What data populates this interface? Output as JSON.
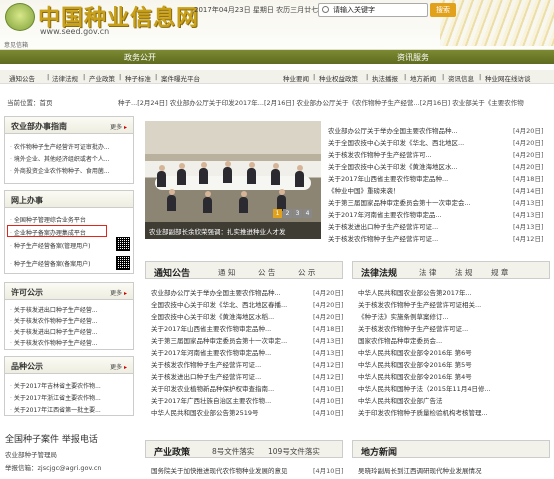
{
  "header": {
    "title": "中国种业信息网",
    "url": "www.seed.gov.cn",
    "date": "2017年04月23日 星期日 农历三月廿七",
    "search_placeholder": "请输入关键字",
    "search_button": "搜索",
    "feedback": "意见信箱"
  },
  "nav": {
    "left": "政务公开",
    "right": "资讯服务"
  },
  "subnav": {
    "left": [
      "通知公告",
      "法律法规",
      "产业政策",
      "种子标准",
      "案件曝光平台"
    ],
    "right": [
      "种业要闻",
      "种业权益政策",
      "执法播报",
      "地方新闻",
      "资讯信息",
      "种业网在线访谈"
    ]
  },
  "breadcrumb": {
    "label": "当前位置：",
    "home": "首页"
  },
  "ticker": "种子...[2月24日]    农业部办公厅关于印发2017年...[2月16日]    农业部办公厅关于《农作物种子生产经营...[2月16日]    农业部关于《主要农作物",
  "left_panels": {
    "guide": {
      "title": "农业部办事指南",
      "more": "更多",
      "items": [
        "农作物种子生产经营许可证审批办...",
        "境外企业、其他经济组织或者个人...",
        "外商投资企业农作物种子、食用菌..."
      ]
    },
    "online": {
      "title": "网上办事",
      "items": [
        "全国种子管理综合业务平台",
        "企业种子备案办理集成平台",
        "种子生产经营备案(管理用户)",
        "种子生产经营备案(备案用户)"
      ]
    },
    "permit": {
      "title": "许可公示",
      "more": "更多",
      "items": [
        "关于核发进出口种子生产经营...",
        "关于核发农作物种子生产经营...",
        "关于核发进出口种子生产经营...",
        "关于核发农作物种子生产经营..."
      ]
    },
    "variety": {
      "title": "品种公示",
      "more": "更多",
      "items": [
        "关于2017年吉林省主要农作物...",
        "关于2017年浙江省主要农作物...",
        "关于2017年江西省第一批主要..."
      ]
    }
  },
  "photo_caption": "农业部副部长余欣荣强调：扎实推进种业人才发",
  "slide_numbers": [
    "1",
    "2",
    "3",
    "4"
  ],
  "news": [
    {
      "t": "农业部办公厅关于举办全国主要农作物品种...",
      "d": "[4月20日]"
    },
    {
      "t": "关于全国农技中心关于印发《华北、西北地区...",
      "d": "[4月20日]"
    },
    {
      "t": "关于核发农作物种子生产经营许可...",
      "d": "[4月20日]"
    },
    {
      "t": "关于全国农技中心关于印发《黄淮海地区水...",
      "d": "[4月20日]"
    },
    {
      "t": "关于2017年山西省主要农作物审定品种...",
      "d": "[4月18日]"
    },
    {
      "t": "《种业中国》重磅来袭！",
      "d": "[4月14日]"
    },
    {
      "t": "关于第三届国家品种审定委员会第十一次审定会...",
      "d": "[4月13日]"
    },
    {
      "t": "关于2017年河南省主要农作物审定品...",
      "d": "[4月13日]"
    },
    {
      "t": "关于核发进出口种子生产经营许可证...",
      "d": "[4月13日]"
    },
    {
      "t": "关于核发农作物种子生产经营许可证...",
      "d": "[4月12日]"
    }
  ],
  "notice": {
    "title": "通知公告",
    "tabs": [
      "通 知",
      "公 告",
      "公 示"
    ],
    "more": "更多",
    "rows": [
      {
        "t": "农业部办公厅关于举办全国主要农作物品种...",
        "d": "[4月20日]"
      },
      {
        "t": "全国农技中心关于印发《华北、西北地区春播...",
        "d": "[4月20日]"
      },
      {
        "t": "全国农技中心关于印发《黄淮海地区水稻...",
        "d": "[4月20日]"
      },
      {
        "t": "关于2017年山西省主要农作物审定品种...",
        "d": "[4月18日]"
      },
      {
        "t": "关于第三届国家品种审定委员会第十一次审定...",
        "d": "[4月13日]"
      },
      {
        "t": "关于2017年河南省主要农作物审定品种...",
        "d": "[4月13日]"
      },
      {
        "t": "关于核发农作物种子生产经营许可证...",
        "d": "[4月12日]"
      },
      {
        "t": "关于核发进出口种子生产经营许可证...",
        "d": "[4月12日]"
      },
      {
        "t": "关于印发农业植物新品种保护权审查指南...",
        "d": "[4月10日]"
      },
      {
        "t": "关于2017年广西壮族自治区主要农作物...",
        "d": "[4月10日]"
      },
      {
        "t": "中华人民共和国农业部公告第2519号",
        "d": "[4月10日]"
      }
    ]
  },
  "law": {
    "title": "法律法规",
    "tabs": [
      "法 律",
      "法 规",
      "规 章"
    ],
    "more": "更多",
    "rows": [
      {
        "t": "中华人民共和国农业部公告第2017年...",
        "d": ""
      },
      {
        "t": "关于核发农作物种子生产经营许可证相关...",
        "d": ""
      },
      {
        "t": "《种子法》实施条例草案修订...",
        "d": ""
      },
      {
        "t": "关于核发农作物种子生产经营许可证...",
        "d": ""
      },
      {
        "t": "国家农作物品种审定委员会...",
        "d": ""
      },
      {
        "t": "中华人民共和国农业部令2016年 第6号",
        "d": ""
      },
      {
        "t": "中华人民共和国农业部令2016年 第5号",
        "d": ""
      },
      {
        "t": "中华人民共和国农业部令2016年 第4号",
        "d": ""
      },
      {
        "t": "中华人民共和国种子法（2015年11月4日修...",
        "d": ""
      },
      {
        "t": "中华人民共和国农业部广告法",
        "d": ""
      },
      {
        "t": "关于印发农作物种子质量检验机构考核管理...",
        "d": ""
      }
    ]
  },
  "policy": {
    "title": "产业政策",
    "tabs": [
      "8号文件落实",
      "109号文件落实"
    ],
    "first": "国务院关于加快推进现代农作物种业发展的意见",
    "first_date": "[4月10日]"
  },
  "local": {
    "title": "地方新闻",
    "first": "吴晓玲副局长到江西调研现代种业发展情况"
  },
  "footer": {
    "title": "全国种子案件 举报电话",
    "sub": "农业部种子管理局",
    "email": "举报信箱：zjscjgc@agri.gov.cn"
  }
}
